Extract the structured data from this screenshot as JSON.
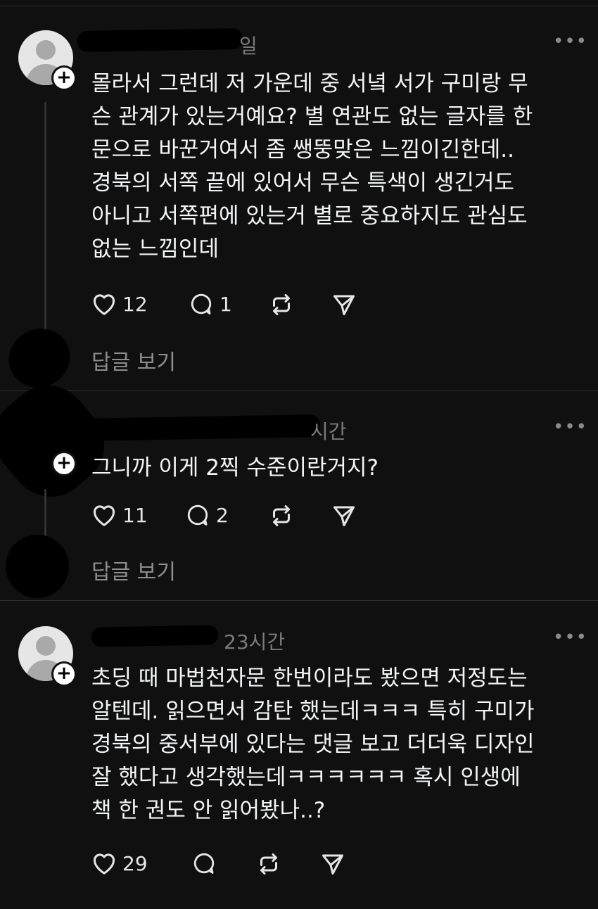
{
  "posts": [
    {
      "time": "일",
      "content": "몰라서 그런데 저 가운데 중 서녘 서가 구미랑 무\n슨 관계가 있는거예요? 별 연관도 없는 글자를 한\n문으로 바꾼거여서 좀 쌩뚱맞은 느낌이긴한데..\n경북의 서쪽 끝에 있어서 무슨 특색이 생긴거도\n아니고 서쪽편에 있는거 별로 중요하지도 관심도\n없는 느낌인데",
      "likes": "12",
      "comments": "1",
      "view_replies": "답글 보기"
    },
    {
      "time": "시간",
      "content": "그니까 이게 2찍 수준이란거지?",
      "likes": "11",
      "comments": "2",
      "view_replies": "답글 보기"
    },
    {
      "time": "23시간",
      "content": "초딩 때 마법천자문 한번이라도 봤으면 저정도는\n알텐데. 읽으면서 감탄 했는데ㅋㅋㅋ 특히 구미가\n경북의 중서부에 있다는 댓글 보고 더더욱 디자인\n잘 했다고 생각했는데ㅋㅋㅋㅋㅋㅋ 혹시 인생에\n책 한 권도 안 읽어봤나..?",
      "likes": "29",
      "comments": ""
    }
  ],
  "icons": {
    "more": "more-icon",
    "like": "heart-icon",
    "comment": "comment-icon",
    "repost": "repost-icon",
    "share": "send-icon",
    "follow": "plus-icon"
  },
  "colors": {
    "background": "#101010",
    "text": "#f3f5f7",
    "muted": "#7a7a7a"
  }
}
